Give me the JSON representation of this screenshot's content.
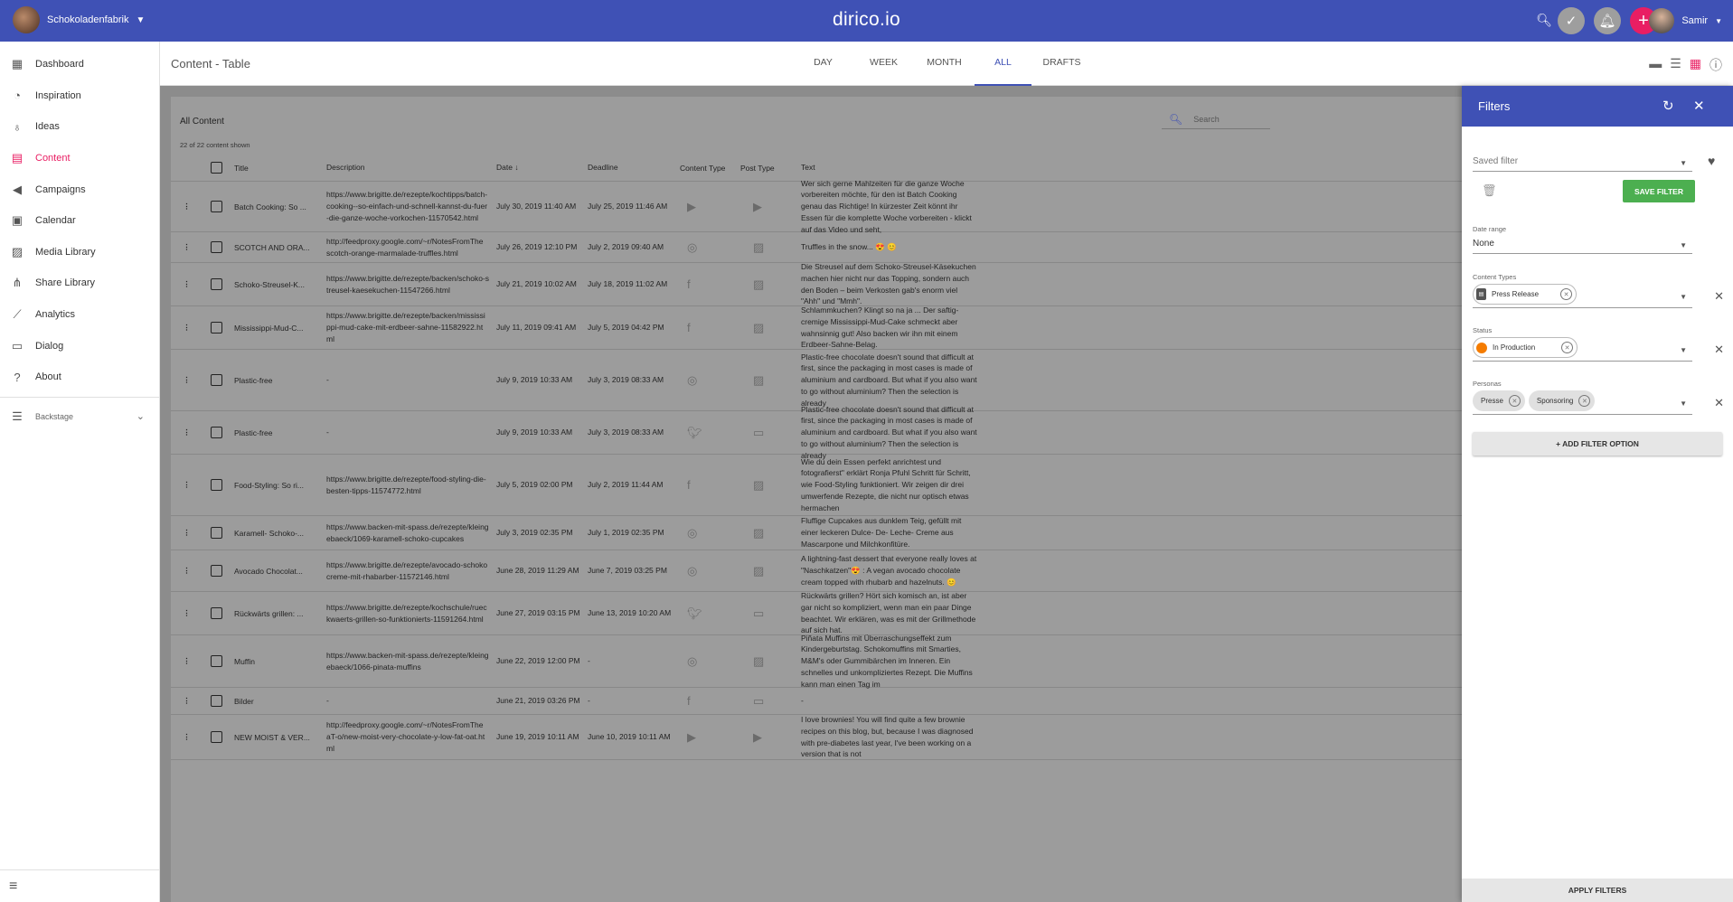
{
  "topbar": {
    "org_name": "Schokoladenfabrik",
    "brand": "dirico.io",
    "user_name": "Samir",
    "colors": {
      "primary": "#3f51b5",
      "accent": "#e91e63"
    }
  },
  "sidebar": {
    "items": [
      {
        "label": "Dashboard",
        "icon": "dashboard-icon"
      },
      {
        "label": "Inspiration",
        "icon": "rss-icon"
      },
      {
        "label": "Ideas",
        "icon": "lightbulb-icon"
      },
      {
        "label": "Content",
        "icon": "content-icon",
        "active": true
      },
      {
        "label": "Campaigns",
        "icon": "megaphone-icon"
      },
      {
        "label": "Calendar",
        "icon": "calendar-icon"
      },
      {
        "label": "Media Library",
        "icon": "photo-library-icon"
      },
      {
        "label": "Share Library",
        "icon": "share-icon"
      },
      {
        "label": "Analytics",
        "icon": "chart-icon"
      },
      {
        "label": "Dialog",
        "icon": "chat-icon"
      },
      {
        "label": "About",
        "icon": "help-icon"
      }
    ],
    "backstage_label": "Backstage"
  },
  "header": {
    "title": "Content - Table",
    "tabs": [
      "DAY",
      "WEEK",
      "MONTH",
      "ALL",
      "DRAFTS"
    ],
    "active_tab": "ALL"
  },
  "table": {
    "title": "All Content",
    "count_text": "22 of 22 content shown",
    "search_placeholder": "Search",
    "columns": [
      "Title",
      "Description",
      "Date",
      "Deadline",
      "Content Type",
      "Post Type",
      "Text"
    ],
    "rows": [
      {
        "title": "Batch Cooking: So ...",
        "description": "https://www.brigitte.de/rezepte/kochtipps/batch-cooking--so-einfach-und-schnell-kannst-du-fuer-die-ganze-woche-vorkochen-11570542.html",
        "date": "July 30, 2019 11:40 AM",
        "deadline": "July 25, 2019 11:46 AM",
        "content_type": "youtube-icon",
        "post_type": "video-icon",
        "text": "Wer sich gerne Mahlzeiten für die ganze Woche vorbereiten möchte, für den ist Batch Cooking genau das Richtige! In kürzester Zeit könnt ihr Essen für die komplette Woche vorbereiten - klickt auf das Video und seht,"
      },
      {
        "title": "SCOTCH AND ORA...",
        "description": "http://feedproxy.google.com/~r/NotesFromThe scotch-orange-marmalade-truffles.html",
        "date": "July 26, 2019 12:10 PM",
        "deadline": "July 2, 2019 09:40 AM",
        "content_type": "instagram-icon",
        "post_type": "image-icon",
        "text": "Truffles in the snow... 😍 😊"
      },
      {
        "title": "Schoko-Streusel-K...",
        "description": "https://www.brigitte.de/rezepte/backen/schoko-streusel-kaesekuchen-11547266.html",
        "date": "July 21, 2019 10:02 AM",
        "deadline": "July 18, 2019 11:02 AM",
        "content_type": "facebook-icon",
        "post_type": "image-icon",
        "text": "Die Streusel auf dem Schoko-Streusel-Käsekuchen machen hier nicht nur das Topping, sondern auch den Boden – beim Verkosten gab's enorm viel \"Ahh\" und \"Mmh\"."
      },
      {
        "title": "Mississippi-Mud-C...",
        "description": "https://www.brigitte.de/rezepte/backen/mississippi-mud-cake-mit-erdbeer-sahne-11582922.html",
        "date": "July 11, 2019 09:41 AM",
        "deadline": "July 5, 2019 04:42 PM",
        "content_type": "facebook-icon",
        "post_type": "image-icon",
        "text": "Schlammkuchen? Klingt so na ja ... Der saftig-cremige Mississippi-Mud-Cake schmeckt aber wahnsinnig gut! Also backen wir ihn mit einem Erdbeer-Sahne-Belag."
      },
      {
        "title": "Plastic-free",
        "description": "-",
        "date": "July 9, 2019 10:33 AM",
        "deadline": "July 3, 2019 08:33 AM",
        "content_type": "instagram-icon",
        "post_type": "image-icon",
        "text": "Plastic-free chocolate doesn't sound that difficult at first, since the packaging in most cases is made of aluminium and cardboard. But what if you also want to go without aluminium? Then the selection is already"
      },
      {
        "title": "Plastic-free",
        "description": "-",
        "date": "July 9, 2019 10:33 AM",
        "deadline": "July 3, 2019 08:33 AM",
        "content_type": "twitter-icon",
        "post_type": "text-post-icon",
        "text": "Plastic-free chocolate doesn't sound that difficult at first, since the packaging in most cases is made of aluminium and cardboard. But what if you also want to go without aluminium? Then the selection is already"
      },
      {
        "title": "Food-Styling: So ri...",
        "description": "https://www.brigitte.de/rezepte/food-styling-die-besten-tipps-11574772.html",
        "date": "July 5, 2019 02:00 PM",
        "deadline": "July 2, 2019 11:44 AM",
        "content_type": "facebook-icon",
        "post_type": "image-icon",
        "text": "Wie du dein Essen perfekt anrichtest und fotografierst\" erklärt Ronja Pfuhl Schritt für Schritt, wie Food-Styling funktioniert. Wir zeigen dir drei umwerfende Rezepte, die nicht nur optisch etwas hermachen"
      },
      {
        "title": "Karamell- Schoko-...",
        "description": "https://www.backen-mit-spass.de/rezepte/kleingebaeck/1069-karamell-schoko-cupcakes",
        "date": "July 3, 2019 02:35 PM",
        "deadline": "July 1, 2019 02:35 PM",
        "content_type": "instagram-icon",
        "post_type": "image-icon",
        "text": "Fluffige Cupcakes aus dunklem Teig, gefüllt mit einer leckeren Dulce- De- Leche- Creme aus Mascarpone und Milchkonfitüre."
      },
      {
        "title": "Avocado Chocolat...",
        "description": "https://www.brigitte.de/rezepte/avocado-schokocreme-mit-rhabarber-11572146.html",
        "date": "June 28, 2019 11:29 AM",
        "deadline": "June 7, 2019 03:25 PM",
        "content_type": "instagram-icon",
        "post_type": "image-icon",
        "text": "A lightning-fast dessert that everyone really loves at \"Naschkatzen\"😍 : A vegan avocado chocolate cream topped with rhubarb and hazelnuts. 😊"
      },
      {
        "title": "Rückwärts grillen: ...",
        "description": "https://www.brigitte.de/rezepte/kochschule/rueckwaerts-grillen-so-funktionierts-11591264.html",
        "date": "June 27, 2019 03:15 PM",
        "deadline": "June 13, 2019 10:20 AM",
        "content_type": "twitter-icon",
        "post_type": "text-post-icon",
        "text": "Rückwärts grillen? Hört sich komisch an, ist aber gar nicht so kompliziert, wenn man ein paar Dinge beachtet. Wir erklären, was es mit der Grillmethode auf sich hat."
      },
      {
        "title": "Muffin",
        "description": "https://www.backen-mit-spass.de/rezepte/kleingebaeck/1066-pinata-muffins",
        "date": "June 22, 2019 12:00 PM",
        "deadline": "-",
        "content_type": "instagram-icon",
        "post_type": "image-icon",
        "text": "Piñata Muffins mit Überraschungseffekt zum Kindergeburtstag. Schokomuffins mit Smarties, M&M's oder Gummibärchen im Inneren. Ein schnelles und unkompliziertes Rezept. Die Muffins kann man einen Tag im"
      },
      {
        "title": "Bilder",
        "description": "-",
        "date": "June 21, 2019 03:26 PM",
        "deadline": "-",
        "content_type": "facebook-icon",
        "post_type": "text-post-icon",
        "text": "-"
      },
      {
        "title": "NEW MOIST & VER...",
        "description": "http://feedproxy.google.com/~r/NotesFromThe aT-o/new-moist-very-chocolate-y-low-fat-oat.html",
        "date": "June 19, 2019 10:11 AM",
        "deadline": "June 10, 2019 10:11 AM",
        "content_type": "youtube-icon",
        "post_type": "video-icon",
        "text": "I love brownies! You will find quite a few brownie recipes on this blog, but, because I was diagnosed with pre-diabetes last year, I've been working on a version that is not"
      }
    ]
  },
  "filters": {
    "title": "Filters",
    "saved_filter_placeholder": "Saved filter",
    "save_button": "SAVE FILTER",
    "date_range_label": "Date range",
    "date_range_value": "None",
    "content_types_label": "Content Types",
    "content_types_chips": [
      "Press Release"
    ],
    "status_label": "Status",
    "status_chips": [
      "In Production"
    ],
    "status_color": "#f57c00",
    "personas_label": "Personas",
    "personas_chips": [
      "Presse",
      "Sponsoring"
    ],
    "add_button": "+ ADD FILTER OPTION",
    "apply_button": "APPLY FILTERS",
    "save_color": "#4caf50"
  }
}
